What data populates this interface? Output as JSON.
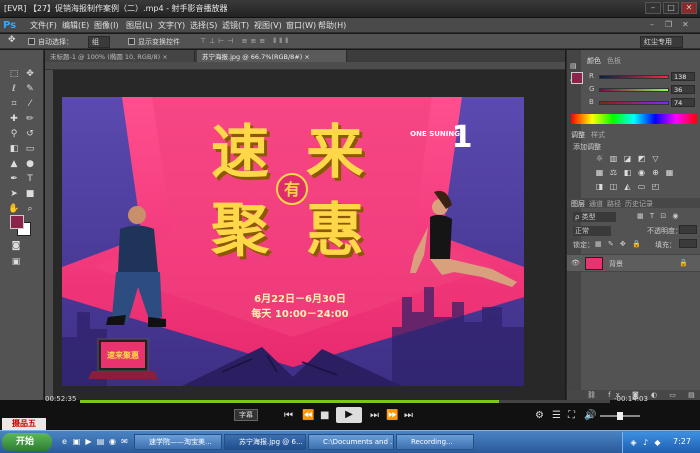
{
  "window": {
    "title": "[EVR] 【27】促销海报制作案例（二）.mp4 - 射手影音播放器",
    "min": "–",
    "max": "□",
    "close": "✕"
  },
  "menu": [
    "文件(F)",
    "编辑(E)",
    "图像(I)",
    "图层(L)",
    "文字(Y)",
    "选择(S)",
    "滤镜(T)",
    "视图(V)",
    "窗口(W)",
    "帮助(H)"
  ],
  "options": {
    "auto_select": "自动选择：",
    "select_value": "组",
    "show_transform": "显示变换控件",
    "workspace": "红尘专用"
  },
  "tabs": [
    {
      "label": "未标题-1 @ 100% (椭圆 10, RGB/8)",
      "close": "×"
    },
    {
      "label": "苏宁海报.jpg @ 66.7%(RGB/8#)",
      "close": "×"
    }
  ],
  "poster": {
    "title_chars": [
      "速",
      "来",
      "聚",
      "惠"
    ],
    "center_char": "有",
    "brand_number": "1",
    "brand_text": "ONE SUNING",
    "date_line": "6月22日－6月30日",
    "time_line": "每天 10:00－24:00",
    "laptop_text": "速来聚惠"
  },
  "panels": {
    "color_tabs": [
      "颜色",
      "色板"
    ],
    "rgb": [
      {
        "channel": "R",
        "value": "138"
      },
      {
        "channel": "G",
        "value": "36"
      },
      {
        "channel": "B",
        "value": "74"
      }
    ],
    "fg_color": "#8a244a",
    "adjust_tabs": [
      "调整",
      "样式"
    ],
    "adjust_title": "添加调整",
    "layer_tabs": [
      "图层",
      "通道",
      "路径",
      "历史记录"
    ],
    "kind": "ρ 类型",
    "blend_mode": "正常",
    "opacity_label": "不透明度：",
    "lock_label": "锁定：",
    "fill_label": "填充：",
    "layer_name": "背景"
  },
  "player": {
    "time_elapsed": "00:52:35",
    "time_remaining": "-00:14:03",
    "subtitle_btn": "字幕",
    "progress": 0.79
  },
  "taskbar": {
    "start": "开始",
    "tasks": [
      "速学院——淘宝美...",
      "苏宁海报.jpg @ 6...",
      "C:\\Documents and ...",
      "Recording..."
    ],
    "clock": "7:27"
  },
  "corner_logo": "摄品五"
}
